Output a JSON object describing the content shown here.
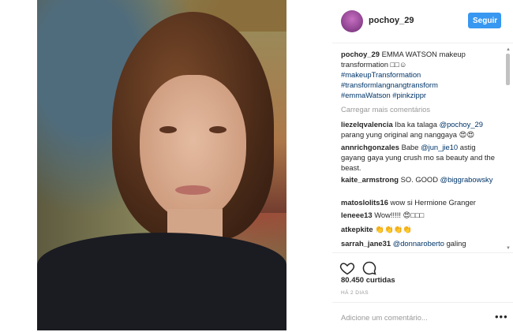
{
  "post": {
    "username": "pochoy_29",
    "follow_label": "Seguir",
    "caption": {
      "user": "pochoy_29",
      "text": "EMMA WATSON makeup transformation □□☺",
      "hashtags": [
        "#makeupTransformation",
        "#transformlangnangtransform",
        "#emmaWatson #pinkzippr"
      ]
    },
    "load_more": "Carregar mais comentários",
    "comments": [
      {
        "user": "liezelqvalencia",
        "pre": "Iba ka talaga ",
        "mention": "@pochoy_29",
        "post": " parang yung original ang nanggaya 😍😍"
      },
      {
        "user": "annrichgonzales",
        "pre": "Babe ",
        "mention": "@jun_jie10",
        "post": " astig gayang gaya yung crush mo sa beauty and the beast."
      },
      {
        "user": "kaite_armstrong",
        "pre": "SO. GOOD ",
        "mention": "@biggrabowsky",
        "post": ""
      },
      {
        "user": "matoslolits16",
        "pre": "wow si Hermione Granger",
        "mention": "",
        "post": ""
      },
      {
        "user": "leneee13",
        "pre": "Wow!!!!! 😍□□□",
        "mention": "",
        "post": ""
      },
      {
        "user": "atkepkite",
        "pre": "👏👏👏👏",
        "mention": "",
        "post": ""
      },
      {
        "user": "sarrah_jane31",
        "pre": "",
        "mention": "@donnaroberto",
        "post": " galing"
      }
    ],
    "likes": "80.450 curtidas",
    "time": "HÁ 2 DIAS",
    "add_comment_placeholder": "Adicione um comentário...",
    "more_options": "•••",
    "icons": {
      "like": "heart-icon",
      "comment": "comment-icon",
      "avatar": "avatar"
    }
  },
  "colors": {
    "accent": "#3897f0",
    "link": "#003569",
    "muted": "#999999"
  }
}
